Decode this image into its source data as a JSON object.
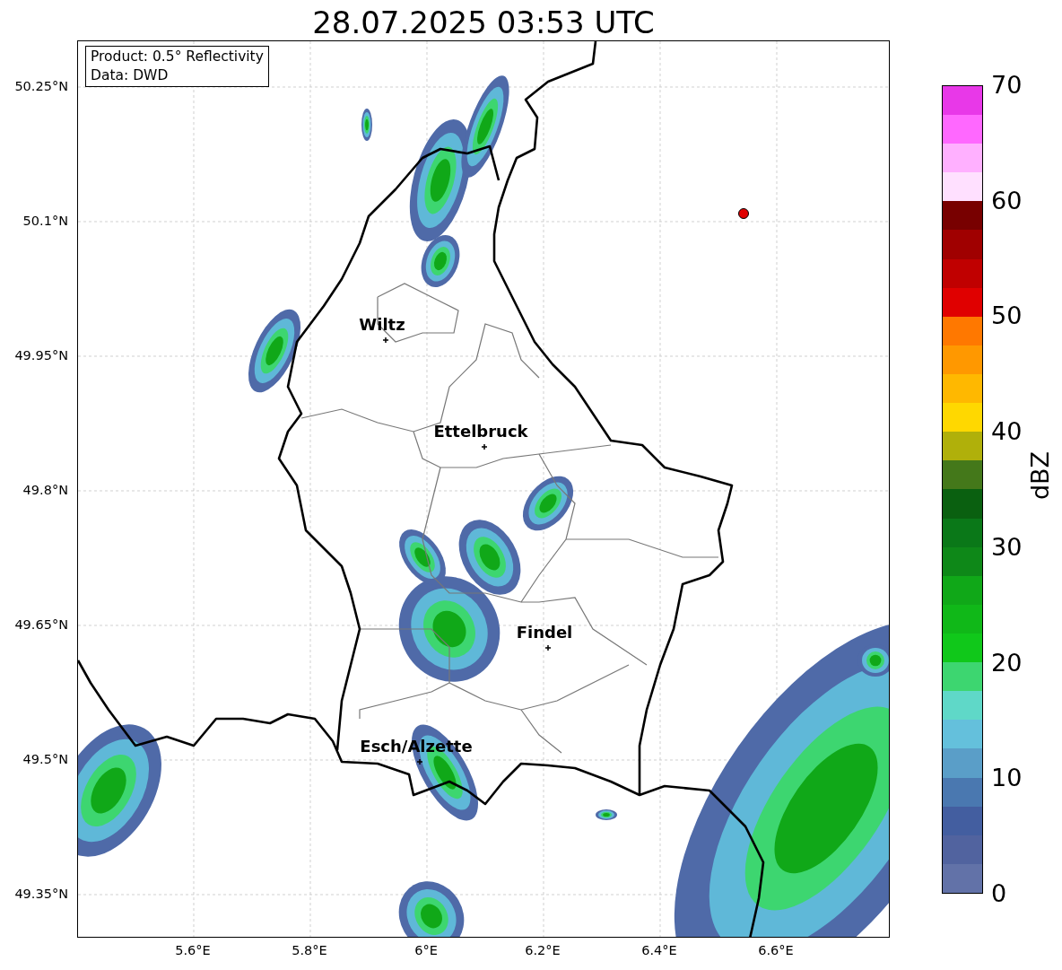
{
  "title": "28.07.2025 03:53 UTC",
  "info_box": [
    "Product: 0.5° Reflectivity",
    "Data: DWD"
  ],
  "map": {
    "xticks": [
      "5.6°E",
      "5.8°E",
      "6°E",
      "6.2°E",
      "6.4°E",
      "6.6°E"
    ],
    "yticks": [
      "50.25°N",
      "50.1°N",
      "49.95°N",
      "49.8°N",
      "49.65°N",
      "49.5°N",
      "49.35°N"
    ],
    "cities": [
      {
        "name": "Wiltz"
      },
      {
        "name": "Ettelbruck"
      },
      {
        "name": "Findel"
      },
      {
        "name": "Esch/Alzette"
      }
    ]
  },
  "colorbar": {
    "label": "dBZ",
    "ticks": [
      "70",
      "60",
      "50",
      "40",
      "30",
      "20",
      "10",
      "0"
    ],
    "bins": [
      {
        "color": "#6272a8"
      },
      {
        "color": "#51639f"
      },
      {
        "color": "#435ea0"
      },
      {
        "color": "#4a78b0"
      },
      {
        "color": "#5a9ec8"
      },
      {
        "color": "#64c0dc"
      },
      {
        "color": "#5fd8c8"
      },
      {
        "color": "#3dd670"
      },
      {
        "color": "#10c81a"
      },
      {
        "color": "#10b818"
      },
      {
        "color": "#10a818"
      },
      {
        "color": "#0e8818"
      },
      {
        "color": "#0a7818"
      },
      {
        "color": "#0a6010"
      },
      {
        "color": "#44781a"
      },
      {
        "color": "#b0b00a"
      },
      {
        "color": "#ffd800"
      },
      {
        "color": "#ffb800"
      },
      {
        "color": "#ff9800"
      },
      {
        "color": "#ff7800"
      },
      {
        "color": "#e00000"
      },
      {
        "color": "#c00000"
      },
      {
        "color": "#a00000"
      },
      {
        "color": "#780000"
      },
      {
        "color": "#ffe0ff"
      },
      {
        "color": "#ffb0ff"
      },
      {
        "color": "#ff68ff"
      },
      {
        "color": "#e838e8"
      }
    ]
  }
}
